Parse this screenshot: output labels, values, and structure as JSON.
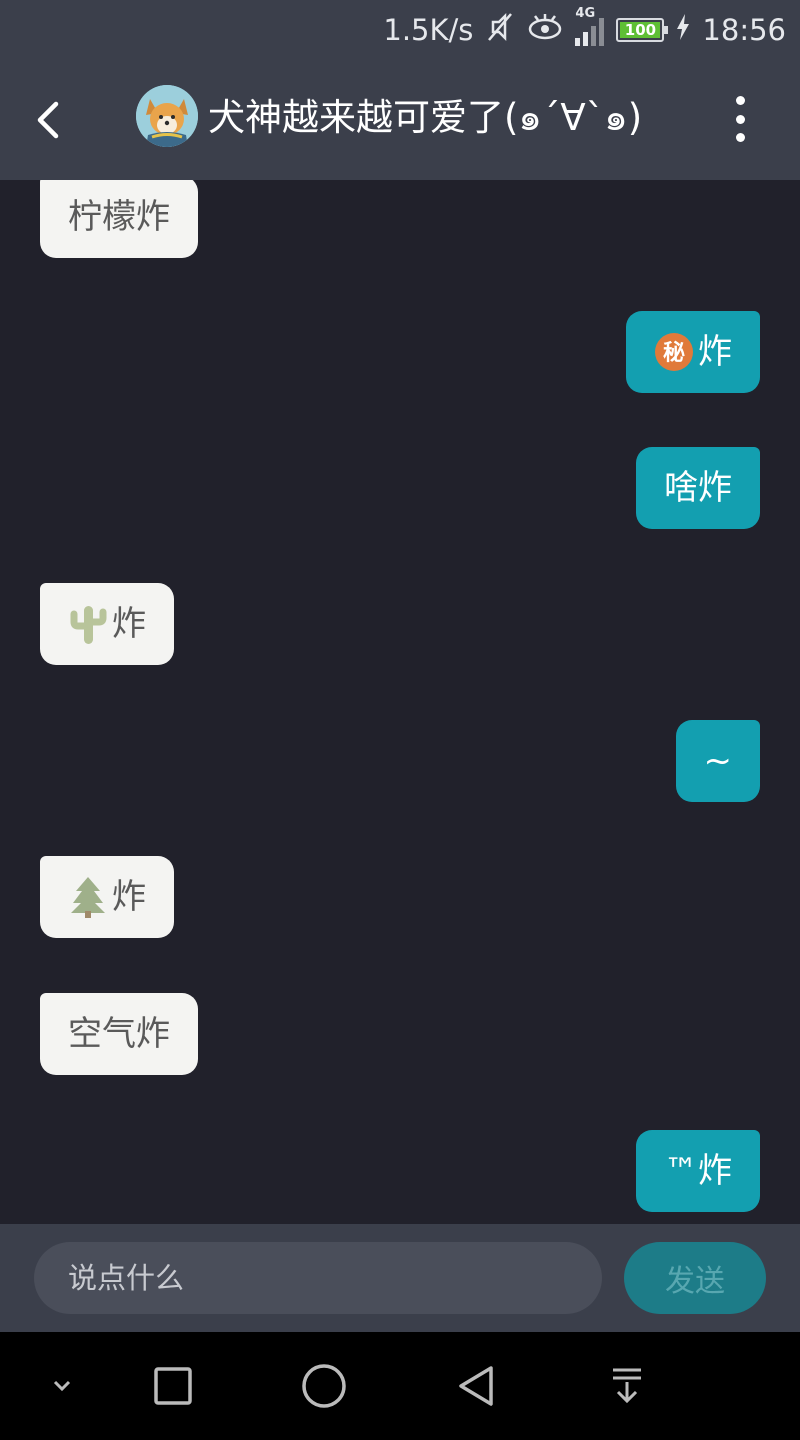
{
  "status_bar": {
    "speed": "1.5K/s",
    "network": "4G",
    "battery": "100",
    "time": "18:56"
  },
  "header": {
    "title": "犬神越来越可爱了(๑´∀`๑)"
  },
  "messages": [
    {
      "side": "in",
      "text": "柠檬炸"
    },
    {
      "side": "out",
      "text": "炸",
      "emoji": "secret-emoji"
    },
    {
      "side": "out",
      "text": "啥炸"
    },
    {
      "side": "in",
      "text": "炸",
      "emoji": "cactus-emoji"
    },
    {
      "side": "out",
      "text": "~"
    },
    {
      "side": "in",
      "text": "炸",
      "emoji": "tree-emoji"
    },
    {
      "side": "in",
      "text": "空气炸"
    },
    {
      "side": "out",
      "text": "™炸"
    }
  ],
  "input": {
    "placeholder": "说点什么"
  },
  "send_button": {
    "label": "发送"
  },
  "colors": {
    "background": "#21212b",
    "header": "#3b3f4b",
    "outgoing_bubble": "#139fb0",
    "incoming_bubble": "#f4f4f2",
    "send_button": "#1d7c88"
  }
}
